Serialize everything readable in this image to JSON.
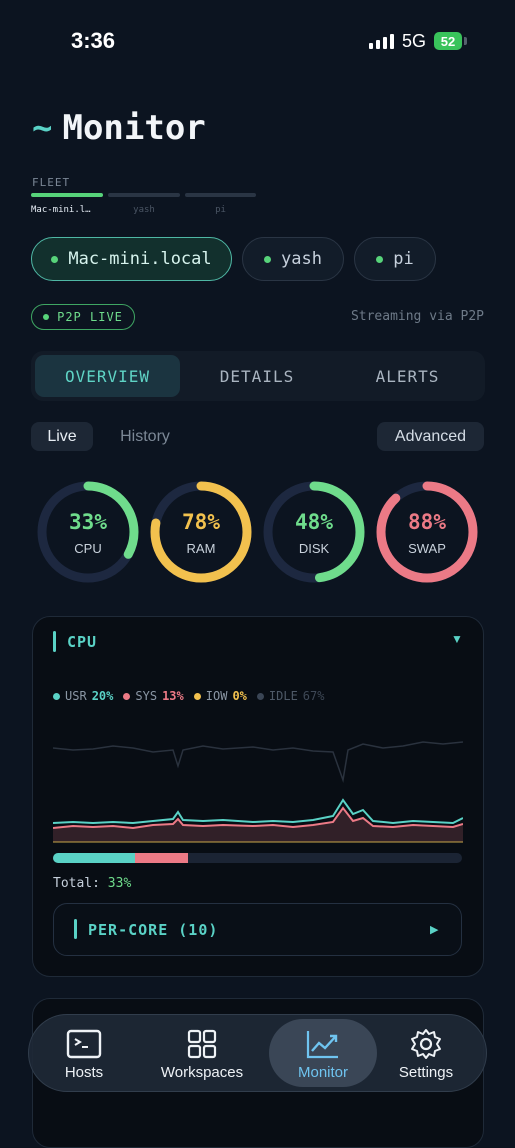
{
  "status_bar": {
    "time": "3:36",
    "network": "5G",
    "battery": "52"
  },
  "header": {
    "tilde": "~",
    "title": "Monitor"
  },
  "fleet": {
    "label": "FLEET",
    "items": [
      {
        "name": "Mac-mini.l…",
        "color": "#57d37a",
        "active": true
      },
      {
        "name": "yash",
        "color": "#2a3544",
        "active": false
      },
      {
        "name": "pi",
        "color": "#2a3544",
        "active": false
      }
    ]
  },
  "hosts": [
    {
      "label": "Mac-mini.local",
      "active": true
    },
    {
      "label": "yash",
      "active": false
    },
    {
      "label": "pi",
      "active": false
    }
  ],
  "connection": {
    "badge": "P2P LIVE",
    "streaming_text": "Streaming via P2P"
  },
  "tabs": [
    {
      "label": "OVERVIEW",
      "active": true
    },
    {
      "label": "DETAILS",
      "active": false
    },
    {
      "label": "ALERTS",
      "active": false
    }
  ],
  "mode": {
    "live": "Live",
    "history": "History",
    "advanced": "Advanced"
  },
  "gauges": [
    {
      "label": "CPU",
      "percent": 33,
      "text": "33%",
      "color": "#6fdc8c"
    },
    {
      "label": "RAM",
      "percent": 78,
      "text": "78%",
      "color": "#f2c14e"
    },
    {
      "label": "DISK",
      "percent": 48,
      "text": "48%",
      "color": "#6fdc8c"
    },
    {
      "label": "SWAP",
      "percent": 88,
      "text": "88%",
      "color": "#ec7a86"
    }
  ],
  "cpu_card": {
    "title": "CPU",
    "legend": [
      {
        "key": "USR",
        "value": "20%",
        "color": "#5ad2c6"
      },
      {
        "key": "SYS",
        "value": "13%",
        "color": "#ec7a86"
      },
      {
        "key": "IOW",
        "value": "0%",
        "color": "#f2c14e"
      },
      {
        "key": "IDLE",
        "value": "67%",
        "color": "#3a4555"
      }
    ],
    "split": {
      "usr": 20,
      "sys": 13
    },
    "total_label": "Total:",
    "total_value": "33%",
    "per_core_label": "PER-CORE (10)"
  },
  "nav": [
    {
      "label": "Hosts",
      "icon": "terminal-icon",
      "active": false
    },
    {
      "label": "Workspaces",
      "icon": "grid-icon",
      "active": false
    },
    {
      "label": "Monitor",
      "icon": "chart-line-icon",
      "active": true
    },
    {
      "label": "Settings",
      "icon": "gear-icon",
      "active": false
    }
  ],
  "colors": {
    "accent": "#5ad2c6",
    "good": "#6fdc8c",
    "warn": "#f2c14e",
    "bad": "#ec7a86",
    "background": "#0c1420"
  }
}
